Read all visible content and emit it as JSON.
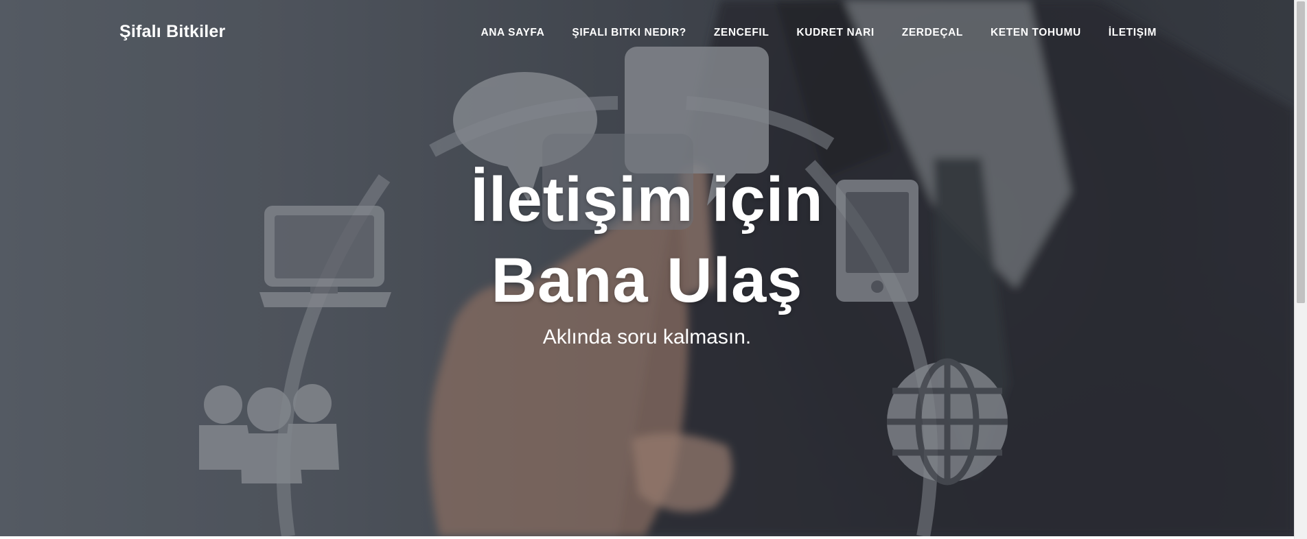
{
  "brand": {
    "name": "Şifalı Bitkiler"
  },
  "nav": {
    "items": [
      {
        "label": "ANA SAYFA"
      },
      {
        "label": "ŞIFALI BITKI NEDIR?"
      },
      {
        "label": "ZENCEFIL"
      },
      {
        "label": "KUDRET NARI"
      },
      {
        "label": "ZERDEÇAL"
      },
      {
        "label": "KETEN TOHUMU"
      },
      {
        "label": "İLETIŞIM"
      }
    ]
  },
  "hero": {
    "title_line1": "İletişim için",
    "title_line2": "Bana Ulaş",
    "subtitle": "Aklında soru kalmasın.",
    "background_icons": [
      "speech-bubble-icon",
      "chat-bubble-icon",
      "laptop-icon",
      "tablet-icon",
      "users-icon",
      "globe-icon"
    ]
  },
  "colors": {
    "hero_overlay": "#4a4f57",
    "text": "#ffffff",
    "icon_fill": "#9a9ea6"
  }
}
